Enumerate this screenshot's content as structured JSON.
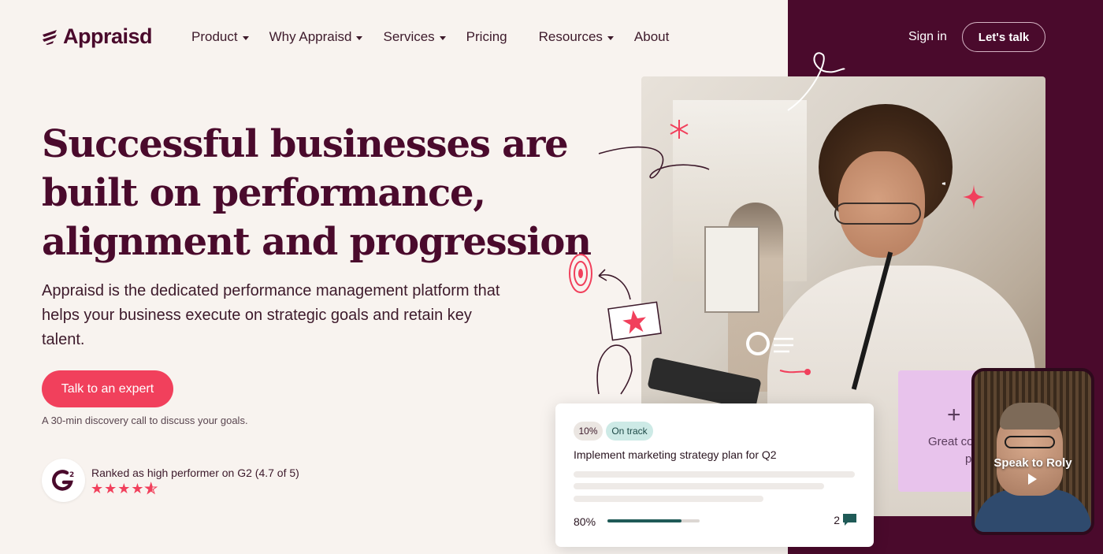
{
  "brand": {
    "name": "Appraisd",
    "accent": "#f1405c",
    "dark": "#4a0a2c"
  },
  "nav": {
    "items": [
      {
        "label": "Product",
        "dropdown": true
      },
      {
        "label": "Why Appraisd",
        "dropdown": true
      },
      {
        "label": "Services",
        "dropdown": true
      },
      {
        "label": "Pricing",
        "dropdown": false
      },
      {
        "label": "Resources",
        "dropdown": true
      },
      {
        "label": "About",
        "dropdown": false
      }
    ],
    "signin": "Sign in",
    "cta": "Let's talk"
  },
  "hero": {
    "headline": [
      "Successful businesses are",
      "built on performance,",
      "alignment and progression"
    ],
    "subtext": "Appraisd is the dedicated performance management platform that helps your business execute on strategic goals and retain key talent.",
    "cta": "Talk to an expert",
    "cta_note": "A 30-min discovery call to discuss your goals.",
    "rating": {
      "text": "Ranked as high performer on G2 (4.7 of 5)",
      "value": 4.7,
      "max": 5,
      "badge_icon": "g2-logo-icon"
    }
  },
  "goal_card": {
    "percent_tag": "10%",
    "status_tag": "On track",
    "title": "Implement marketing strategy plan for Q2",
    "progress_label": "80%",
    "progress": 0.8,
    "comments": "2"
  },
  "pink_card": {
    "line1": "Great co",
    "line2": "pe"
  },
  "video": {
    "label": "Speak to Roly"
  }
}
